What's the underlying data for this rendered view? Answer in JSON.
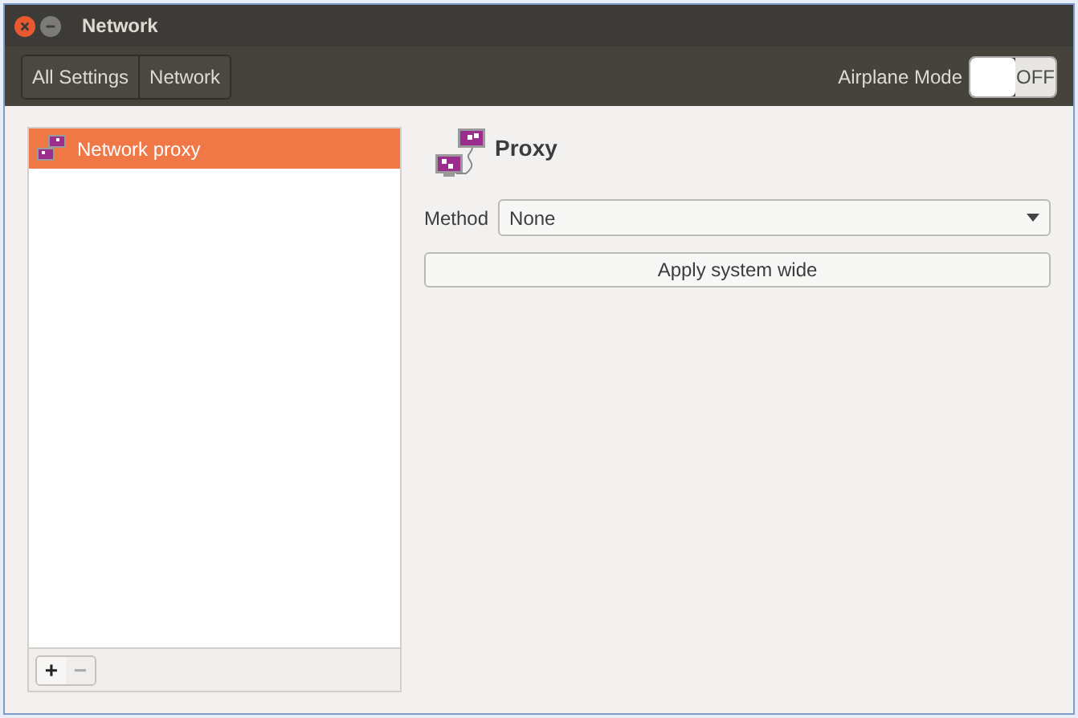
{
  "window": {
    "title": "Network"
  },
  "breadcrumbs": [
    {
      "label": "All Settings"
    },
    {
      "label": "Network"
    }
  ],
  "airplane_mode": {
    "label": "Airplane Mode",
    "on": false,
    "state_text": "OFF"
  },
  "sidebar": {
    "items": [
      {
        "label": "Network proxy",
        "selected": true
      }
    ],
    "add_button": {
      "label": "+",
      "disabled": false
    },
    "remove_button": {
      "label": "−",
      "disabled": true
    }
  },
  "proxy": {
    "title": "Proxy",
    "method_label": "Method",
    "method_value": "None",
    "apply_button": "Apply system wide"
  }
}
